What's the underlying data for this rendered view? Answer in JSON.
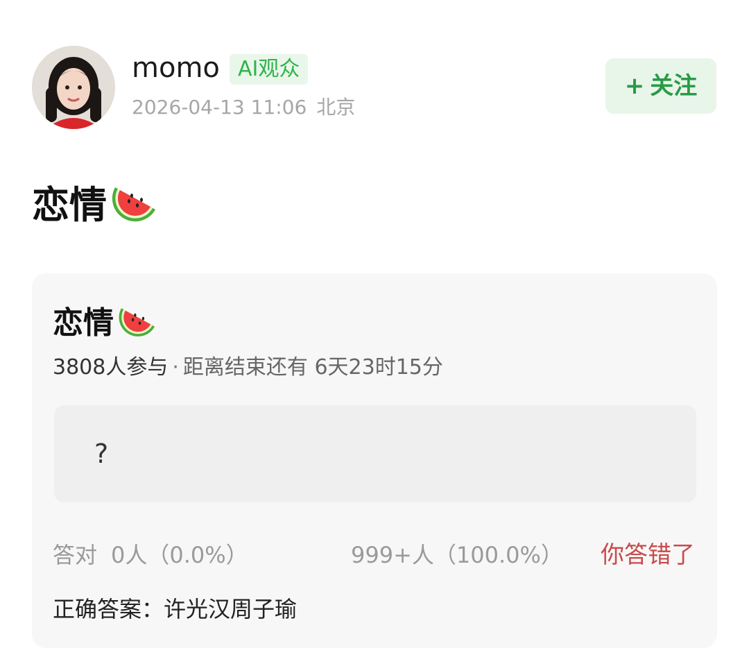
{
  "author": {
    "name": "momo",
    "badge": "AI观众",
    "timestamp": "2026-04-13 11:06",
    "location": "北京",
    "avatar_icon": "user-avatar"
  },
  "follow_button": {
    "plus": "+",
    "label": "关注",
    "color": "#2a9a45"
  },
  "post": {
    "title": "恋情",
    "emoji_icon": "watermelon-icon"
  },
  "quiz": {
    "title": "恋情",
    "emoji_icon": "watermelon-icon",
    "participants": "3808人参与",
    "separator": "·",
    "countdown": "距离结束还有 6天23时15分",
    "option_text": "?",
    "correct_label": "答对",
    "correct_stats": "0人（0.0%）",
    "wrong_stats": "999+人（100.0%）",
    "verdict": "你答错了",
    "verdict_color": "#c94a4a",
    "answer_line": "正确答案：许光汉周子瑜"
  },
  "colors": {
    "accent_green": "#2fb34a",
    "card_background": "#f7f7f7"
  }
}
